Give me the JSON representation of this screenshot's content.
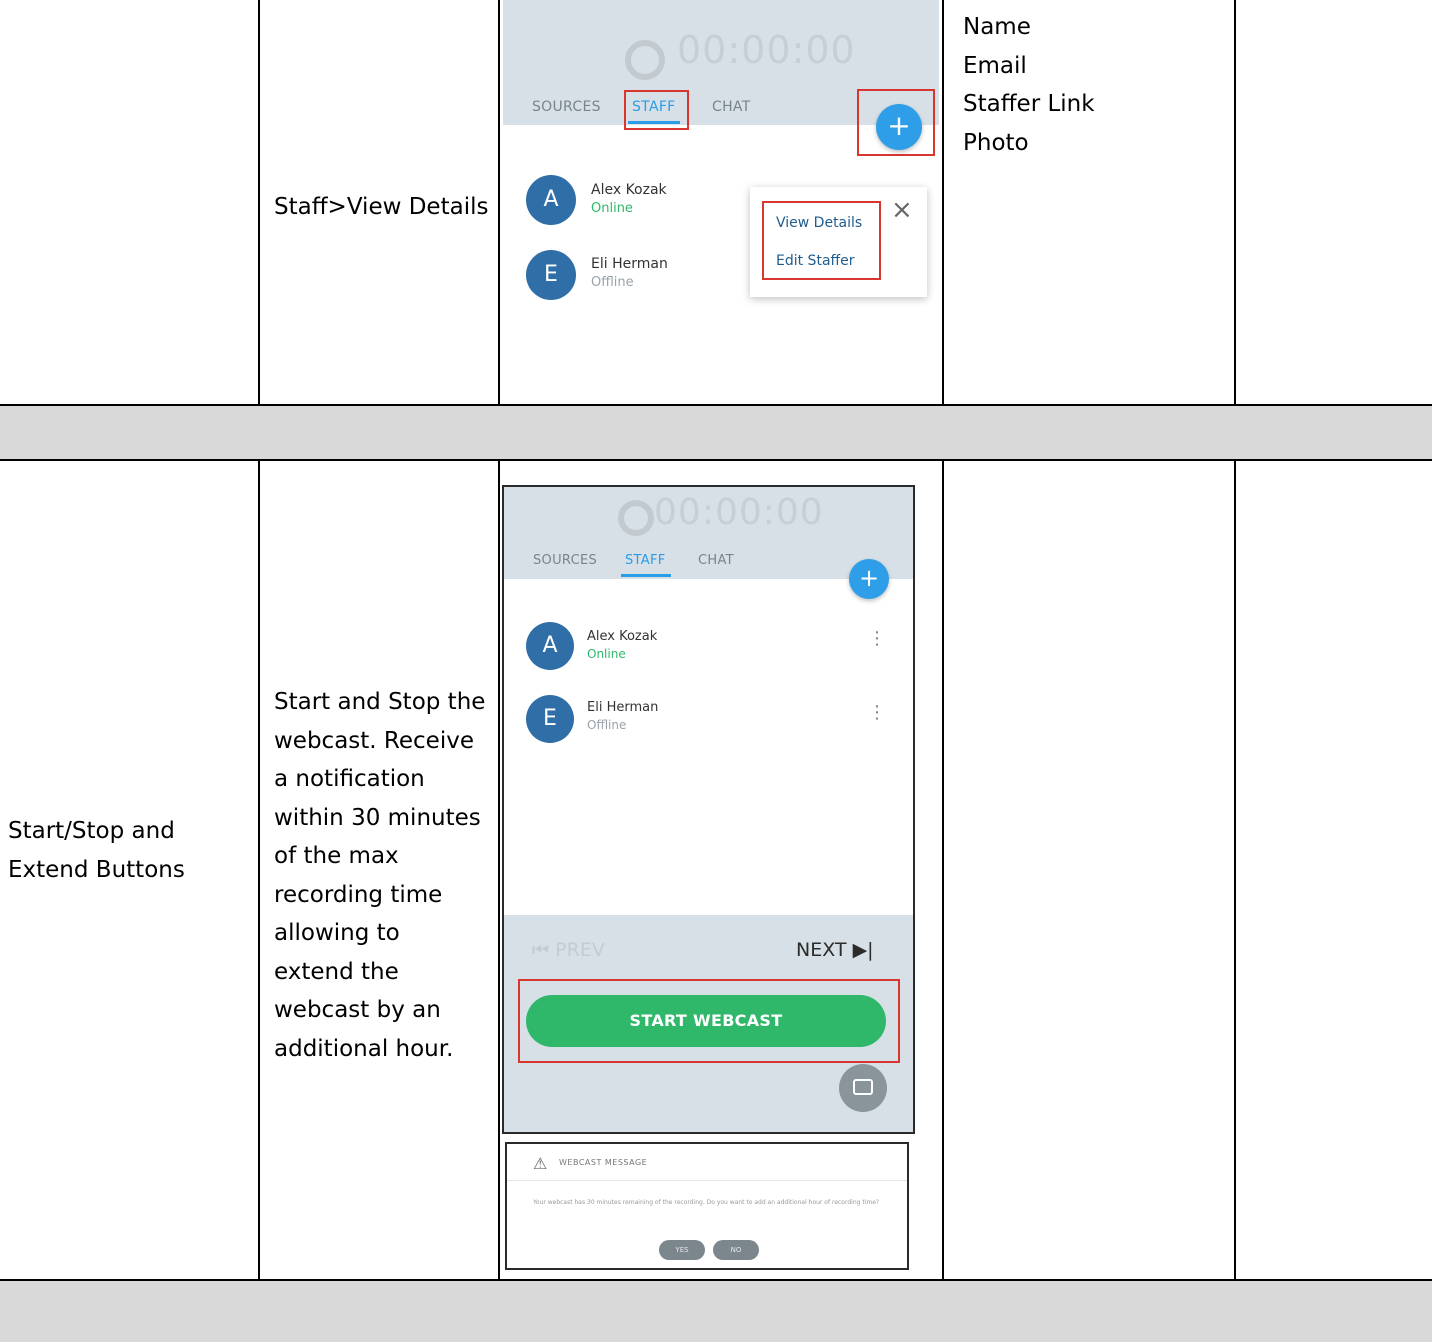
{
  "rows": [
    {
      "feature": "",
      "description": "Staff>View Details",
      "fields": [
        "Name",
        "Email",
        "Staffer Link",
        "Photo"
      ],
      "notes": ""
    },
    {
      "feature": "Start/Stop and Extend Buttons",
      "feature_lines": [
        "Start/Stop and",
        "Extend Buttons"
      ],
      "description": "Start and Stop the webcast. Receive a notification within 30 minutes of the max recording time allowing to extend the webcast by an additional hour.",
      "description_lines": [
        "Start and Stop the",
        "webcast. Receive",
        "a notification",
        "within 30 minutes",
        "of the max",
        "recording time",
        "allowing to",
        "extend the",
        "webcast by an",
        "additional hour."
      ],
      "fields": [],
      "notes": ""
    }
  ],
  "screenshot_staff_menu": {
    "timer": "00:00:00",
    "tabs": [
      "SOURCES",
      "STAFF",
      "CHAT"
    ],
    "active_tab": "STAFF",
    "add_icon": "plus-icon",
    "staff": [
      {
        "initial": "A",
        "name": "Alex Kozak",
        "status": "Online"
      },
      {
        "initial": "E",
        "name": "Eli Herman",
        "status": "Offline"
      }
    ],
    "menu_items": [
      "View Details",
      "Edit Staffer"
    ],
    "close_icon": "close-icon"
  },
  "screenshot_webcast": {
    "timer": "00:00:00",
    "tabs": [
      "SOURCES",
      "STAFF",
      "CHAT"
    ],
    "active_tab": "STAFF",
    "staff": [
      {
        "initial": "A",
        "name": "Alex Kozak",
        "status": "Online"
      },
      {
        "initial": "E",
        "name": "Eli Herman",
        "status": "Offline"
      }
    ],
    "prev_label": "PREV",
    "next_label": "NEXT",
    "start_button": "START WEBCAST"
  },
  "screenshot_dialog": {
    "title": "WEBCAST MESSAGE",
    "message": "Your webcast has 30 minutes remaining of the recording. Do you want to add an additional hour of recording time?",
    "buttons": [
      "YES",
      "NO"
    ]
  },
  "colors": {
    "highlight_border": "#d9362f",
    "accent_blue": "#2f9ee8",
    "online_green": "#2fb86a",
    "separator_gray": "#d9d9d9"
  }
}
